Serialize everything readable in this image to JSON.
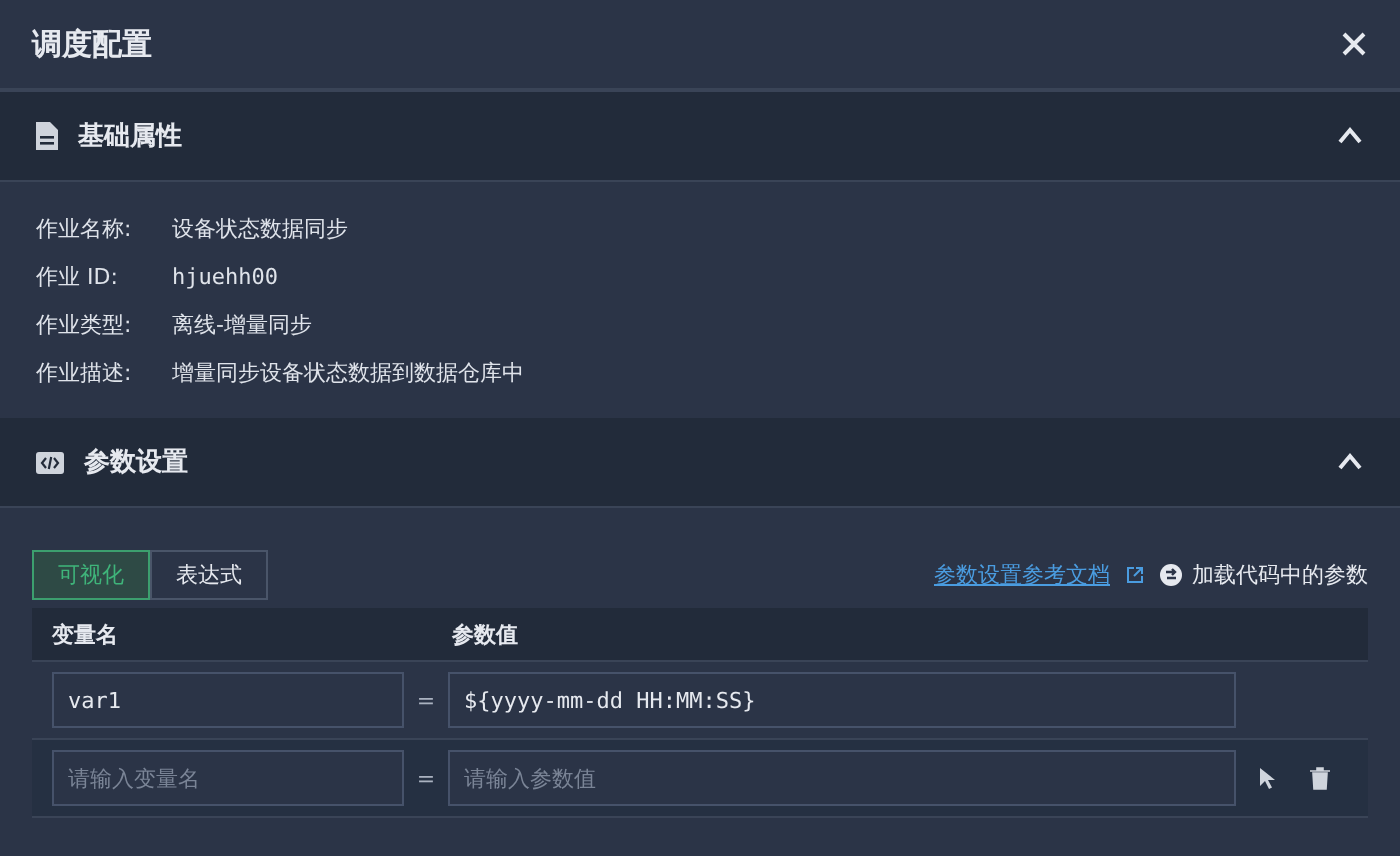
{
  "window": {
    "title": "调度配置"
  },
  "sections": [
    {
      "kind": "info",
      "title": "基础属性",
      "expanded": true,
      "fields": [
        {
          "label": "作业名称:",
          "value": "设备状态数据同步",
          "mono": false
        },
        {
          "label": "作业 ID:",
          "value": "hjuehh00",
          "mono": true
        },
        {
          "label": "作业类型:",
          "value": "离线-增量同步",
          "mono": false
        },
        {
          "label": "作业描述:",
          "value": "增量同步设备状态数据到数据仓库中",
          "mono": false
        }
      ]
    },
    {
      "kind": "params",
      "title": "参数设置",
      "expanded": true,
      "tabs": [
        {
          "label": "可视化",
          "selected": true
        },
        {
          "label": "表达式",
          "selected": false
        }
      ],
      "doc_link": "参数设置参考文档",
      "load_button": "加载代码中的参数",
      "columns": [
        "变量名",
        "参数值"
      ],
      "rows": [
        {
          "name": {
            "value": "var1"
          },
          "equals": "=",
          "param": {
            "value": "${yyyy-mm-dd HH:MM:SS}"
          },
          "hovered": false
        },
        {
          "name": {
            "placeholder": "请输入变量名"
          },
          "equals": "=",
          "param": {
            "placeholder": "请输入参数值"
          },
          "hovered": true
        }
      ]
    }
  ]
}
